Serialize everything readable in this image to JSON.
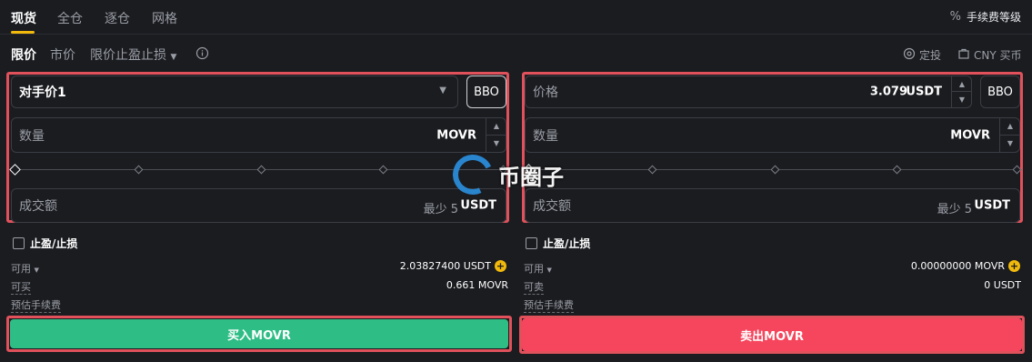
{
  "top_tabs": [
    "现货",
    "全仓",
    "逐仓",
    "网格"
  ],
  "fee_level": {
    "icon": "percent-icon",
    "label": "手续费等级"
  },
  "order_types": {
    "limit": "限价",
    "market": "市价",
    "tpsl": "限价止盈止损"
  },
  "top_right": {
    "dingtou": "定投",
    "buy_cny": "CNY 买币"
  },
  "buy_panel": {
    "price_select": "对手价1",
    "bbo": "BBO",
    "amount_label": "数量",
    "amount_unit": "MOVR",
    "total_label": "成交额",
    "total_min": "最少 5",
    "total_unit": "USDT",
    "tpsl_label": "止盈/止损",
    "available_label": "可用",
    "available_value": "2.03827400 USDT",
    "can_label": "可买",
    "can_value": "0.661 MOVR",
    "fee_label": "预估手续费",
    "button": "买入MOVR"
  },
  "sell_panel": {
    "price_label": "价格",
    "price_value": "3.079",
    "price_unit": "USDT",
    "bbo": "BBO",
    "amount_label": "数量",
    "amount_unit": "MOVR",
    "total_label": "成交额",
    "total_min": "最少 5",
    "total_unit": "USDT",
    "tpsl_label": "止盈/止损",
    "available_label": "可用",
    "available_value": "0.00000000 MOVR",
    "can_label": "可卖",
    "can_value": "0 USDT",
    "fee_label": "预估手续费",
    "button": "卖出MOVR"
  },
  "watermark": "币圈子",
  "colors": {
    "buy": "#2ebd85",
    "sell": "#f6465d",
    "accent": "#f0b90b",
    "highlight": "#e0515b"
  }
}
